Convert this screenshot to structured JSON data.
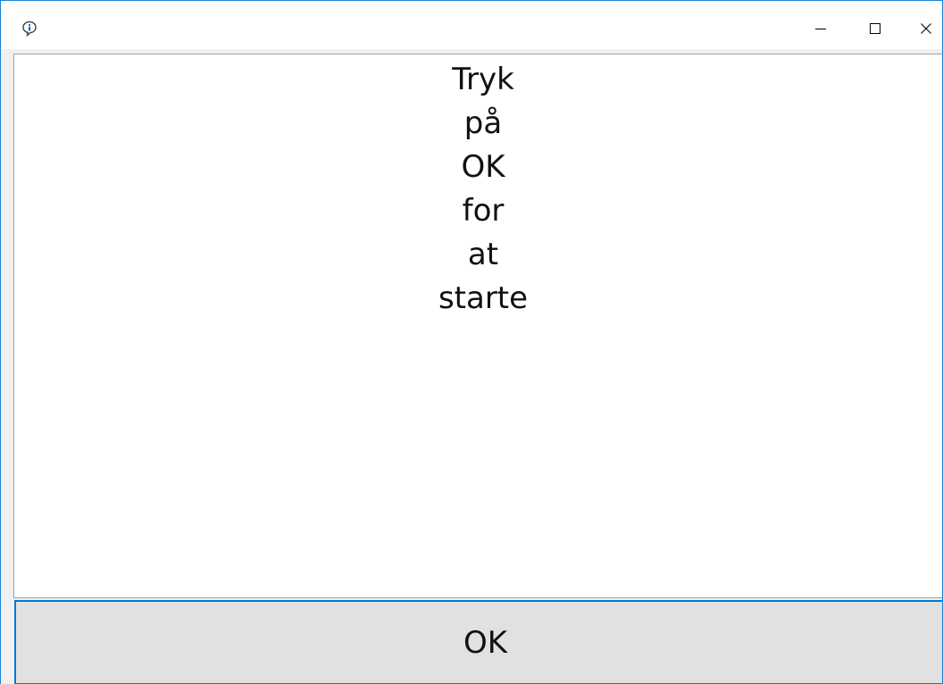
{
  "window": {
    "title": "",
    "icon": "info-balloon-icon",
    "controls": {
      "minimize": "minimize-icon",
      "maximize": "maximize-icon",
      "close": "close-icon"
    }
  },
  "message": {
    "lines": [
      "Tryk",
      "på",
      "OK",
      "for",
      "at",
      "starte"
    ]
  },
  "buttons": {
    "ok_label": "OK"
  },
  "colors": {
    "window_border": "#1883d7",
    "button_focus_border": "#0078d7",
    "button_background": "#e1e1e1",
    "panel_border": "#a0a0a0"
  }
}
